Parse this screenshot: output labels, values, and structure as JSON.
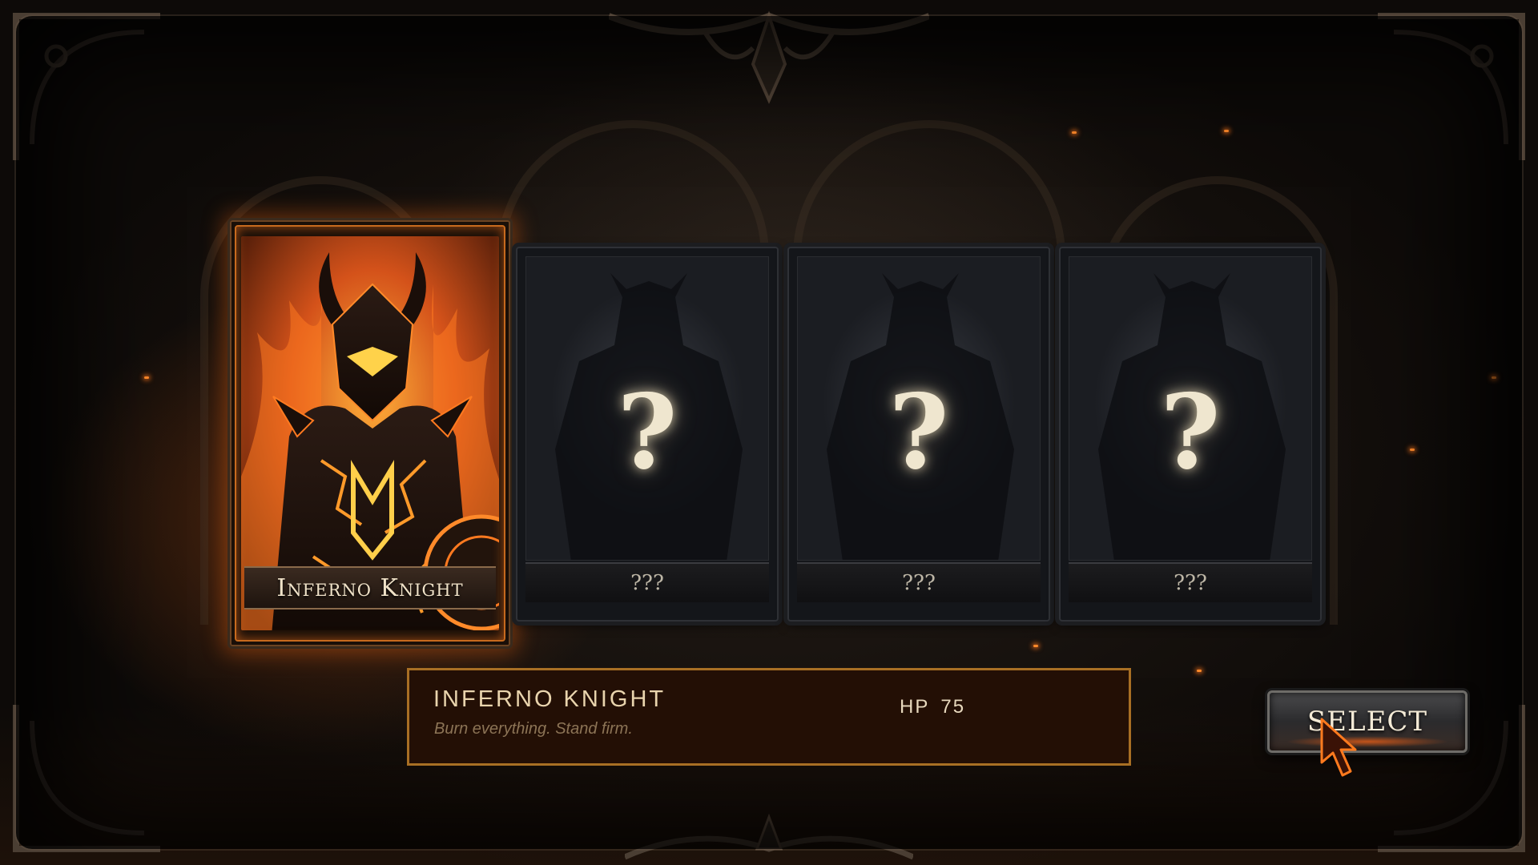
{
  "cards": [
    {
      "name": "Inferno Knight",
      "state": "selected"
    },
    {
      "name": "???",
      "state": "locked"
    },
    {
      "name": "???",
      "state": "locked"
    },
    {
      "name": "???",
      "state": "locked"
    }
  ],
  "info_panel": {
    "name": "INFERNO KNIGHT",
    "description": "Burn everything. Stand firm.",
    "hp_label": "HP",
    "hp_value": "75"
  },
  "select_button": {
    "label": "SELECT"
  },
  "locked_symbol": "?",
  "colors": {
    "accent_gold": "#a86f24",
    "fire_glow": "#ff6e14",
    "panel_bg": "#230f05"
  },
  "icons": {
    "cursor": "arrow-cursor-icon"
  }
}
